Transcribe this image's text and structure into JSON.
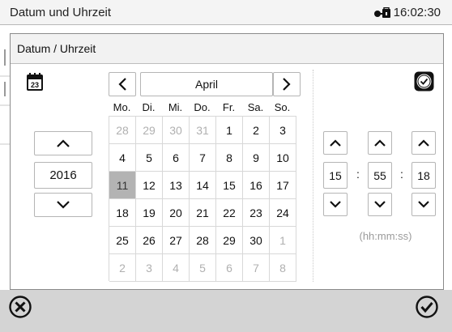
{
  "app": {
    "title": "Datum und Uhrzeit",
    "clock": "16:02:30"
  },
  "dialog": {
    "title": "Datum / Uhrzeit"
  },
  "date": {
    "year": "2016",
    "month": "April",
    "weekdays": [
      "Mo.",
      "Di.",
      "Mi.",
      "Do.",
      "Fr.",
      "Sa.",
      "So."
    ],
    "days": [
      {
        "d": "28",
        "m": true
      },
      {
        "d": "29",
        "m": true
      },
      {
        "d": "30",
        "m": true
      },
      {
        "d": "31",
        "m": true
      },
      {
        "d": "1"
      },
      {
        "d": "2"
      },
      {
        "d": "3"
      },
      {
        "d": "4"
      },
      {
        "d": "5"
      },
      {
        "d": "6"
      },
      {
        "d": "7"
      },
      {
        "d": "8"
      },
      {
        "d": "9"
      },
      {
        "d": "10"
      },
      {
        "d": "11",
        "s": true
      },
      {
        "d": "12"
      },
      {
        "d": "13"
      },
      {
        "d": "14"
      },
      {
        "d": "15"
      },
      {
        "d": "16"
      },
      {
        "d": "17"
      },
      {
        "d": "18"
      },
      {
        "d": "19"
      },
      {
        "d": "20"
      },
      {
        "d": "21"
      },
      {
        "d": "22"
      },
      {
        "d": "23"
      },
      {
        "d": "24"
      },
      {
        "d": "25"
      },
      {
        "d": "26"
      },
      {
        "d": "27"
      },
      {
        "d": "28"
      },
      {
        "d": "29"
      },
      {
        "d": "30"
      },
      {
        "d": "1",
        "m": true
      },
      {
        "d": "2",
        "m": true
      },
      {
        "d": "3",
        "m": true
      },
      {
        "d": "4",
        "m": true
      },
      {
        "d": "5",
        "m": true
      },
      {
        "d": "6",
        "m": true
      },
      {
        "d": "7",
        "m": true
      },
      {
        "d": "8",
        "m": true
      }
    ]
  },
  "time": {
    "hh": "15",
    "mm": "55",
    "ss": "18",
    "sep": ":",
    "format": "(hh:mm:ss)"
  },
  "icons": {
    "lock": "lock-key-icon",
    "calendar": "calendar-icon",
    "clock": "clock-icon",
    "prev": "chevron-left-icon",
    "next": "chevron-right-icon",
    "up": "chevron-up-icon",
    "down": "chevron-down-icon",
    "cancel": "cancel-x-icon",
    "confirm": "confirm-check-icon"
  }
}
